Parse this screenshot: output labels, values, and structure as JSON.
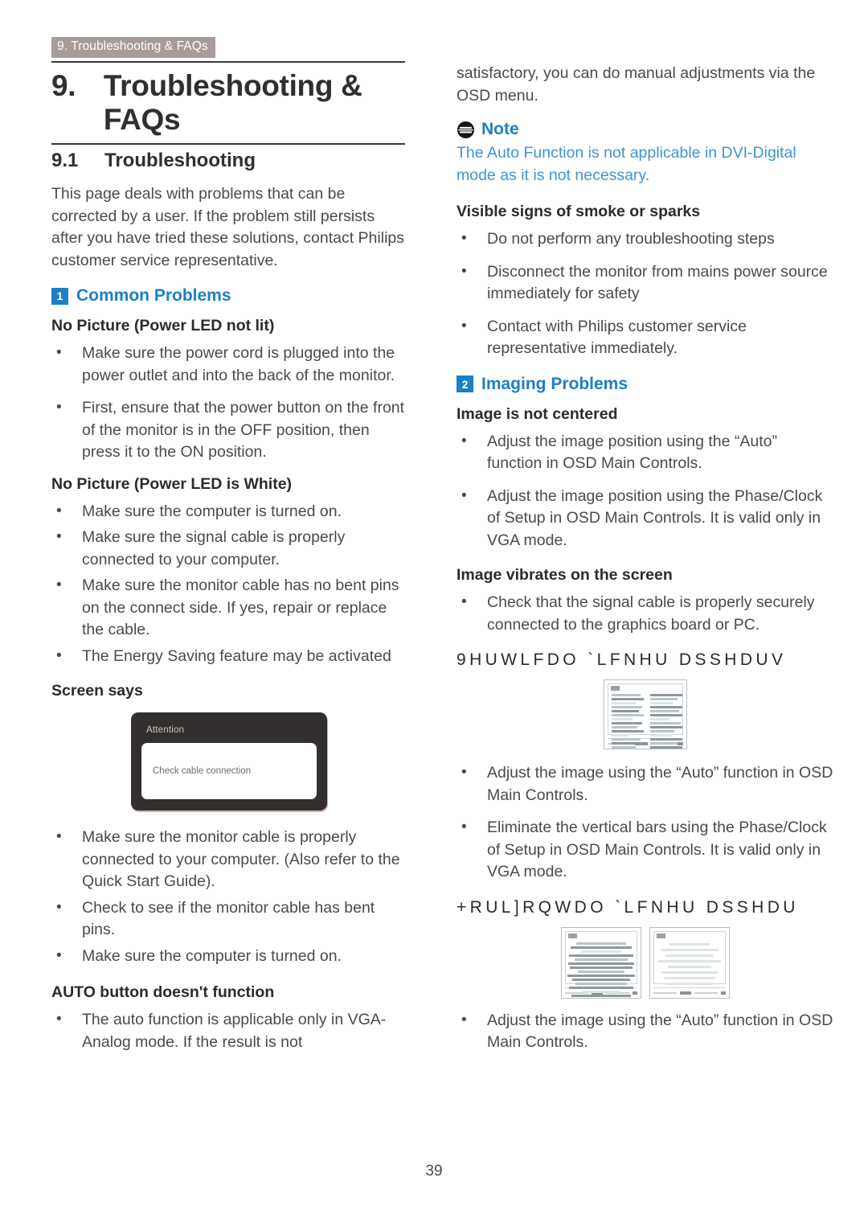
{
  "running_header": "9. Troubleshooting & FAQs",
  "chapter": {
    "number": "9.",
    "title": "Troubleshooting & FAQs"
  },
  "section": {
    "number": "9.1",
    "title": "Troubleshooting"
  },
  "left_column": {
    "intro": "This page deals with problems that can be corrected by a user. If the problem still persists after you have tried these solutions, contact Philips customer service representative.",
    "group1": {
      "badge": "1",
      "label": "Common Problems"
    },
    "heading_led_not_lit": "No Picture (Power LED not lit)",
    "bullets_led_not_lit": [
      "Make sure the power cord is plugged into the power outlet and into the back of the monitor.",
      "First, ensure that the power button on the front of the monitor is in the OFF position, then press it to the ON position."
    ],
    "heading_led_white": "No Picture (Power LED is White)",
    "bullets_led_white": [
      "Make sure the computer is turned on.",
      "Make sure the signal cable is properly connected to your computer.",
      "Make sure the monitor cable has no bent pins on the connect side. If yes, repair or replace the cable.",
      "The Energy Saving feature may be activated"
    ],
    "heading_screen_says": "Screen says",
    "osd": {
      "title": "Attention",
      "message": "Check cable connection"
    },
    "bullets_screen_says": [
      "Make sure the monitor cable is properly connected to your computer. (Also refer to the Quick Start Guide).",
      "Check to see if the monitor cable has bent pins.",
      "Make sure the computer is turned on."
    ],
    "heading_auto_button": "AUTO button doesn't function",
    "bullets_auto_button": [
      "The auto function is applicable only in VGA-Analog mode. If the result is not"
    ]
  },
  "right_column": {
    "continuation": "satisfactory, you can do manual adjustments via the OSD menu.",
    "note": {
      "label": "Note",
      "text": "The Auto Function is not applicable in DVI-Digital mode as it is not necessary."
    },
    "heading_smoke": "Visible signs of smoke or sparks",
    "bullets_smoke": [
      "Do not perform any troubleshooting steps",
      "Disconnect the monitor from mains power source immediately for safety",
      "Contact with Philips customer service representative immediately."
    ],
    "group2": {
      "badge": "2",
      "label": "Imaging Problems"
    },
    "heading_not_centered": "Image is not centered",
    "bullets_not_centered": [
      "Adjust the image position using the “Auto” function in OSD Main Controls.",
      "Adjust the image position using the Phase/Clock of Setup in OSD Main Controls. It is valid only in VGA mode."
    ],
    "heading_vibrates": "Image vibrates on the screen",
    "bullets_vibrates": [
      "Check that the signal cable is properly securely connected to the graphics board or PC."
    ],
    "caption_vertical": "9HUWLFDO `LFNHU DSSHDUV",
    "bullets_vertical": [
      "Adjust the image using the “Auto” function in OSD Main Controls.",
      "Eliminate the vertical bars using the Phase/Clock of Setup in OSD Main Controls. It is valid only in VGA mode."
    ],
    "caption_horizontal": "+RUL]RQWDO `LFNHU DSSHDU",
    "bullets_horizontal": [
      "Adjust the image using the “Auto” function in OSD Main Controls."
    ]
  },
  "page_number": "39",
  "colors": {
    "accent_blue": "#1b80c4",
    "note_blue": "#3d95d4",
    "header_tab_bg": "#a79c9a",
    "osd_bg": "#332f2e"
  }
}
